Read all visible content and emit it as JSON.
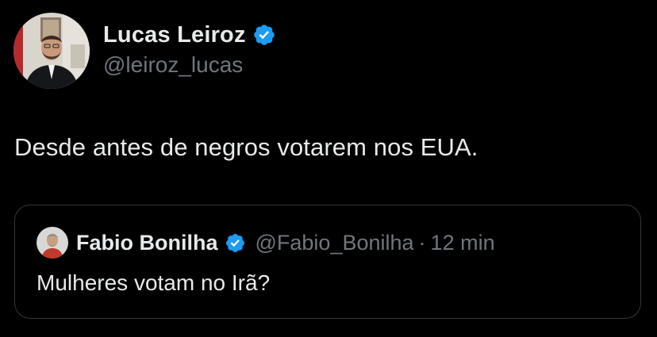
{
  "colors": {
    "background": "#000000",
    "primary_text": "#e7e9ea",
    "secondary_text": "#71767b",
    "verified_blue": "#1d9bf0",
    "quote_border": "#333639"
  },
  "author": {
    "name": "Lucas Leiroz",
    "handle": "@leiroz_lucas",
    "verified": true,
    "avatar_icon": "profile-photo"
  },
  "tweet": {
    "text": "Desde antes de negros votarem nos EUA."
  },
  "quoted_tweet": {
    "author_name": "Fabio Bonilha",
    "handle": "@Fabio_Bonilha",
    "separator": "·",
    "time": "12 min",
    "verified": true,
    "avatar_icon": "profile-photo",
    "text": "Mulheres votam no Irã?"
  }
}
